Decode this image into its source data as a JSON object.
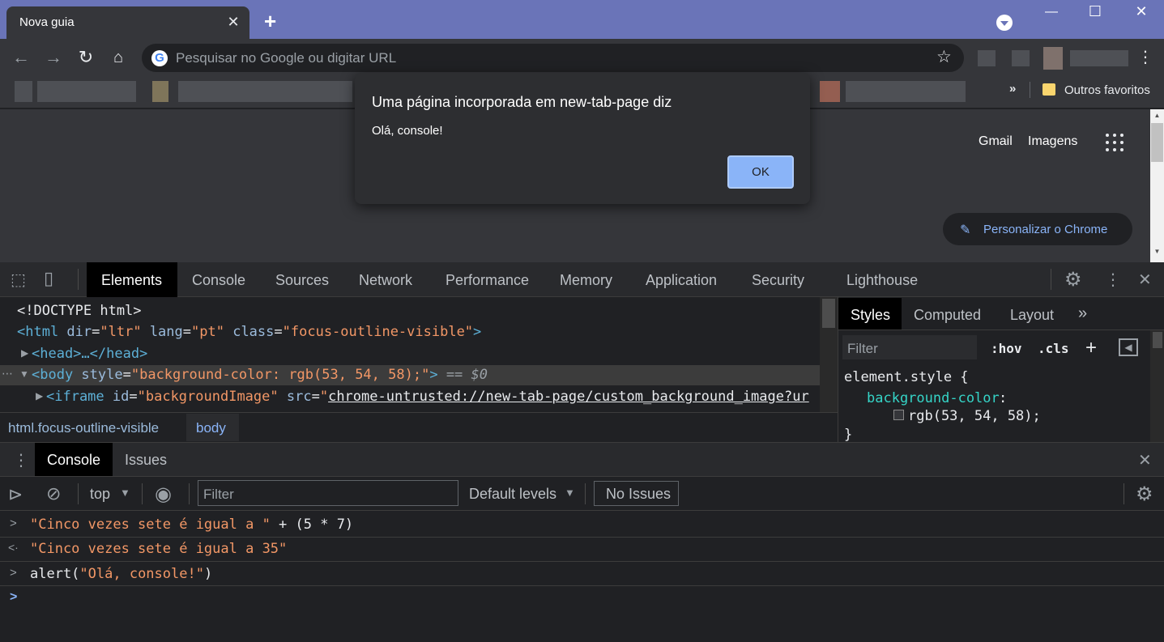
{
  "browser": {
    "tab_title": "Nova guia",
    "tab_close": "✕",
    "new_tab": "+",
    "window_controls": [
      "—",
      "☐",
      "✕"
    ],
    "omnibox_placeholder": "Pesquisar no Google ou digitar URL",
    "google_letter": "G",
    "bookmarks_more": "»",
    "other_favorites": "Outros favoritos"
  },
  "page": {
    "gmail": "Gmail",
    "images": "Imagens",
    "customize": "Personalizar o Chrome"
  },
  "dialog": {
    "title": "Uma página incorporada em new-tab-page diz",
    "message": "Olá, console!",
    "ok": "OK"
  },
  "devtools": {
    "tabs": [
      "Elements",
      "Console",
      "Sources",
      "Network",
      "Performance",
      "Memory",
      "Application",
      "Security",
      "Lighthouse"
    ],
    "active_tab": "Elements",
    "dom": {
      "doctype": "<!DOCTYPE html>",
      "html_open": "<html",
      "html_dir_attr": " dir",
      "html_dir_val": "\"ltr\"",
      "html_lang_attr": " lang",
      "html_lang_val": "\"pt\"",
      "html_class_attr": " class",
      "html_class_val": "\"focus-outline-visible\"",
      "html_close": ">",
      "head": "<head>…</head>",
      "body_open": "<body",
      "body_style_attr": " style",
      "body_style_val": "\"background-color: rgb(53, 54, 58);\"",
      "body_close": ">",
      "body_eq": " == $0",
      "iframe_open": "<iframe",
      "iframe_id_attr": " id",
      "iframe_id_val": "\"backgroundImage\"",
      "iframe_src_attr": " src",
      "iframe_src_val": "chrome-untrusted://new-tab-page/custom_background_image?ur"
    },
    "breadcrumbs": [
      "html.focus-outline-visible",
      "body"
    ],
    "styles": {
      "tabs": [
        "Styles",
        "Computed",
        "Layout",
        "»"
      ],
      "filter_placeholder": "Filter",
      "hov": ":hov",
      "cls": ".cls",
      "plus": "+",
      "rule_selector": "element.style {",
      "prop_name": "background-color",
      "prop_value": "rgb(53, 54, 58);",
      "rule_close": "}"
    },
    "drawer_tabs": [
      "Console",
      "Issues"
    ],
    "console_toolbar": {
      "context": "top",
      "filter_placeholder": "Filter",
      "levels": "Default levels",
      "issues": "No Issues"
    },
    "console_lines": [
      {
        "prompt": ">",
        "text_str": "\"Cinco vezes sete é igual a \"",
        "text_rest": " + (5 * 7)"
      },
      {
        "prompt": "<·",
        "text_str": "\"Cinco vezes sete é igual a 35\""
      },
      {
        "prompt": ">",
        "text_fn": "alert(",
        "text_str": "\"Olá, console!\"",
        "text_end": ")"
      }
    ],
    "console_prompt": ">"
  },
  "colors": {
    "titlebar": "#6a74b8",
    "accent": "#8ab4f8",
    "page_background": "rgb(53, 54, 58)"
  }
}
